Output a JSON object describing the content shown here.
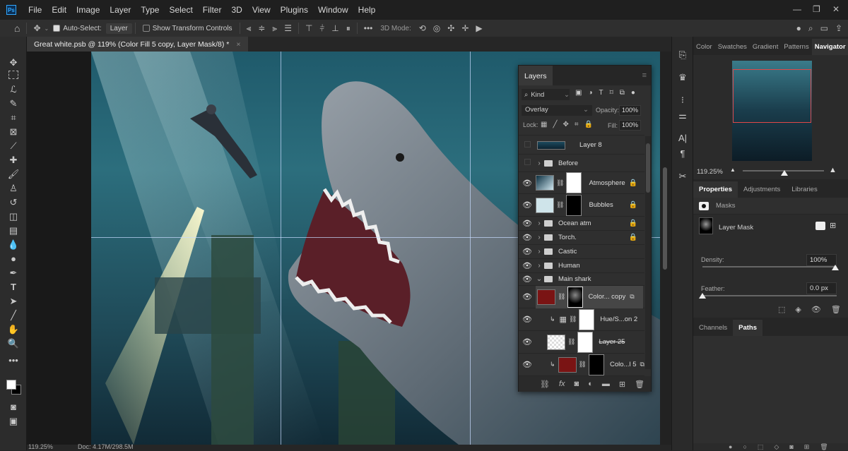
{
  "app": {
    "logo": "Ps",
    "menu": [
      "File",
      "Edit",
      "Image",
      "Layer",
      "Type",
      "Select",
      "Filter",
      "3D",
      "View",
      "Plugins",
      "Window",
      "Help"
    ],
    "window_controls": [
      "minimize",
      "restore",
      "close"
    ]
  },
  "options": {
    "auto_select_label": "Auto-Select:",
    "auto_select_checked": true,
    "auto_select_target": "Layer",
    "show_transform_label": "Show Transform Controls",
    "show_transform_checked": false,
    "more": "•••",
    "mode_3d_label": "3D Mode:"
  },
  "document_tab": {
    "title": "Great white.psb @ 119% (Color Fill 5 copy, Layer Mask/8) *",
    "close": "×"
  },
  "status": {
    "zoom": "119.25%",
    "doc": "Doc: 4.17M/298.5M"
  },
  "layers_panel": {
    "tab": "Layers",
    "filter": "Kind",
    "blend_mode": "Overlay",
    "opacity_label": "Opacity:",
    "opacity": "100%",
    "lock_label": "Lock:",
    "fill_label": "Fill:",
    "fill": "100%",
    "layers": [
      {
        "name": "Layer 8",
        "visible": false,
        "type": "pixel"
      },
      {
        "name": "Before",
        "visible": false,
        "type": "group"
      },
      {
        "name": "Atmosphere",
        "visible": true,
        "type": "masked",
        "locked": true
      },
      {
        "name": "Bubbles",
        "visible": true,
        "type": "masked",
        "locked": true
      },
      {
        "name": "Ocean atm",
        "visible": true,
        "type": "group",
        "locked": true
      },
      {
        "name": "Torch.",
        "visible": true,
        "type": "group",
        "locked": true
      },
      {
        "name": "Castic",
        "visible": true,
        "type": "group"
      },
      {
        "name": "Human",
        "visible": true,
        "type": "group"
      },
      {
        "name": "Main shark",
        "visible": true,
        "type": "group",
        "expanded": true
      },
      {
        "name": "Color... copy",
        "visible": true,
        "type": "fill",
        "selected": true
      },
      {
        "name": "Hue/S...on 2",
        "visible": true,
        "type": "adjustment",
        "clipped": true
      },
      {
        "name": "Layer 25",
        "visible": true,
        "type": "smart",
        "strikethrough": true
      },
      {
        "name": "Colo...l 5",
        "visible": true,
        "type": "fill",
        "clipped": true
      }
    ]
  },
  "navigator": {
    "tabs": [
      "Color",
      "Swatches",
      "Gradient",
      "Patterns",
      "Navigator"
    ],
    "active": "Navigator",
    "zoom": "119.25%",
    "zoom_slider_fraction": 0.55
  },
  "properties": {
    "tabs": [
      "Properties",
      "Adjustments",
      "Libraries"
    ],
    "active": "Properties",
    "section": "Masks",
    "mask_label": "Layer Mask",
    "density_label": "Density:",
    "density": "100%",
    "density_fraction": 1.0,
    "feather_label": "Feather:",
    "feather": "0.0 px",
    "feather_fraction": 0.0
  },
  "paths": {
    "tabs": [
      "Channels",
      "Paths"
    ],
    "active": "Paths"
  },
  "colors": {
    "accent": "#31a8ff",
    "fill_red": "#7a1414",
    "nav_box": "#e04848"
  }
}
